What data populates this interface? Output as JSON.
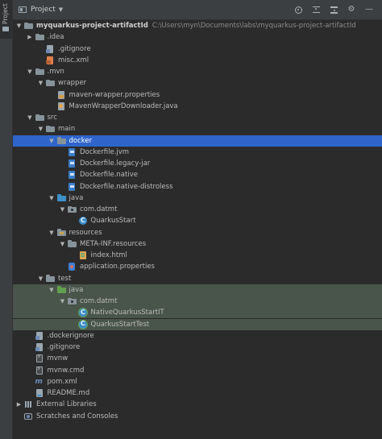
{
  "side_tab": {
    "label": "Project"
  },
  "header": {
    "title": "Project",
    "caret": "▼"
  },
  "tree": [
    {
      "depth": 0,
      "arrow": "down",
      "icon": "folder-icon",
      "label": "myquarkus-project-artifactId",
      "bold": true,
      "path": "C:\\Users\\myn\\Documents\\labs\\myquarkus-project-artifactId"
    },
    {
      "depth": 1,
      "arrow": "right",
      "icon": "folder-icon",
      "label": ".idea"
    },
    {
      "depth": 2,
      "arrow": "none",
      "icon": "gitignore-icon",
      "label": ".gitignore"
    },
    {
      "depth": 2,
      "arrow": "none",
      "icon": "xml-file-icon",
      "label": "misc.xml"
    },
    {
      "depth": 1,
      "arrow": "down",
      "icon": "folder-icon",
      "label": ".mvn"
    },
    {
      "depth": 2,
      "arrow": "down",
      "icon": "folder-icon",
      "label": "wrapper"
    },
    {
      "depth": 3,
      "arrow": "none",
      "icon": "properties-file-icon",
      "label": "maven-wrapper.properties"
    },
    {
      "depth": 3,
      "arrow": "none",
      "icon": "java-file-icon",
      "label": "MavenWrapperDownloader.java"
    },
    {
      "depth": 1,
      "arrow": "down",
      "icon": "folder-icon",
      "label": "src"
    },
    {
      "depth": 2,
      "arrow": "down",
      "icon": "folder-icon",
      "label": "main"
    },
    {
      "depth": 3,
      "arrow": "down",
      "icon": "folder-icon",
      "label": "docker",
      "selected": true
    },
    {
      "depth": 4,
      "arrow": "none",
      "icon": "docker-file-icon",
      "label": "Dockerfile.jvm"
    },
    {
      "depth": 4,
      "arrow": "none",
      "icon": "docker-file-icon",
      "label": "Dockerfile.legacy-jar"
    },
    {
      "depth": 4,
      "arrow": "none",
      "icon": "docker-file-icon",
      "label": "Dockerfile.native"
    },
    {
      "depth": 4,
      "arrow": "none",
      "icon": "docker-file-icon",
      "label": "Dockerfile.native-distroless"
    },
    {
      "depth": 3,
      "arrow": "down",
      "icon": "source-folder-icon",
      "label": "java"
    },
    {
      "depth": 4,
      "arrow": "down",
      "icon": "package-folder-icon",
      "label": "com.datmt"
    },
    {
      "depth": 5,
      "arrow": "none",
      "icon": "class-icon",
      "label": "QuarkusStart"
    },
    {
      "depth": 3,
      "arrow": "down",
      "icon": "resources-folder-icon",
      "label": "resources"
    },
    {
      "depth": 4,
      "arrow": "down",
      "icon": "folder-icon",
      "label": "META-INF.resources"
    },
    {
      "depth": 5,
      "arrow": "none",
      "icon": "html-file-icon",
      "label": "index.html"
    },
    {
      "depth": 4,
      "arrow": "none",
      "icon": "app-properties-icon",
      "label": "application.properties"
    },
    {
      "depth": 2,
      "arrow": "down",
      "icon": "folder-icon",
      "label": "test"
    },
    {
      "depth": 3,
      "arrow": "down",
      "icon": "test-folder-icon",
      "label": "java",
      "test": true
    },
    {
      "depth": 4,
      "arrow": "down",
      "icon": "package-folder-icon",
      "label": "com.datmt",
      "test": true
    },
    {
      "depth": 5,
      "arrow": "none",
      "icon": "test-class-icon",
      "label": "NativeQuarkusStartIT",
      "test": true
    },
    {
      "depth": 5,
      "arrow": "none",
      "icon": "test-class-icon",
      "label": "QuarkusStartTest",
      "test": true
    },
    {
      "depth": 1,
      "arrow": "none",
      "icon": "dockerignore-icon",
      "label": ".dockerignore"
    },
    {
      "depth": 1,
      "arrow": "none",
      "icon": "gitignore-icon",
      "label": ".gitignore"
    },
    {
      "depth": 1,
      "arrow": "none",
      "icon": "terminal-file-icon",
      "label": "mvnw"
    },
    {
      "depth": 1,
      "arrow": "none",
      "icon": "cmd-file-icon",
      "label": "mvnw.cmd"
    },
    {
      "depth": 1,
      "arrow": "none",
      "icon": "maven-pom-icon",
      "label": "pom.xml"
    },
    {
      "depth": 1,
      "arrow": "none",
      "icon": "markdown-file-icon",
      "label": "README.md"
    },
    {
      "depth": 0,
      "arrow": "right",
      "icon": "library-icon",
      "label": "External Libraries"
    },
    {
      "depth": 0,
      "arrow": "none",
      "icon": "scratches-icon",
      "label": "Scratches and Consoles"
    }
  ]
}
